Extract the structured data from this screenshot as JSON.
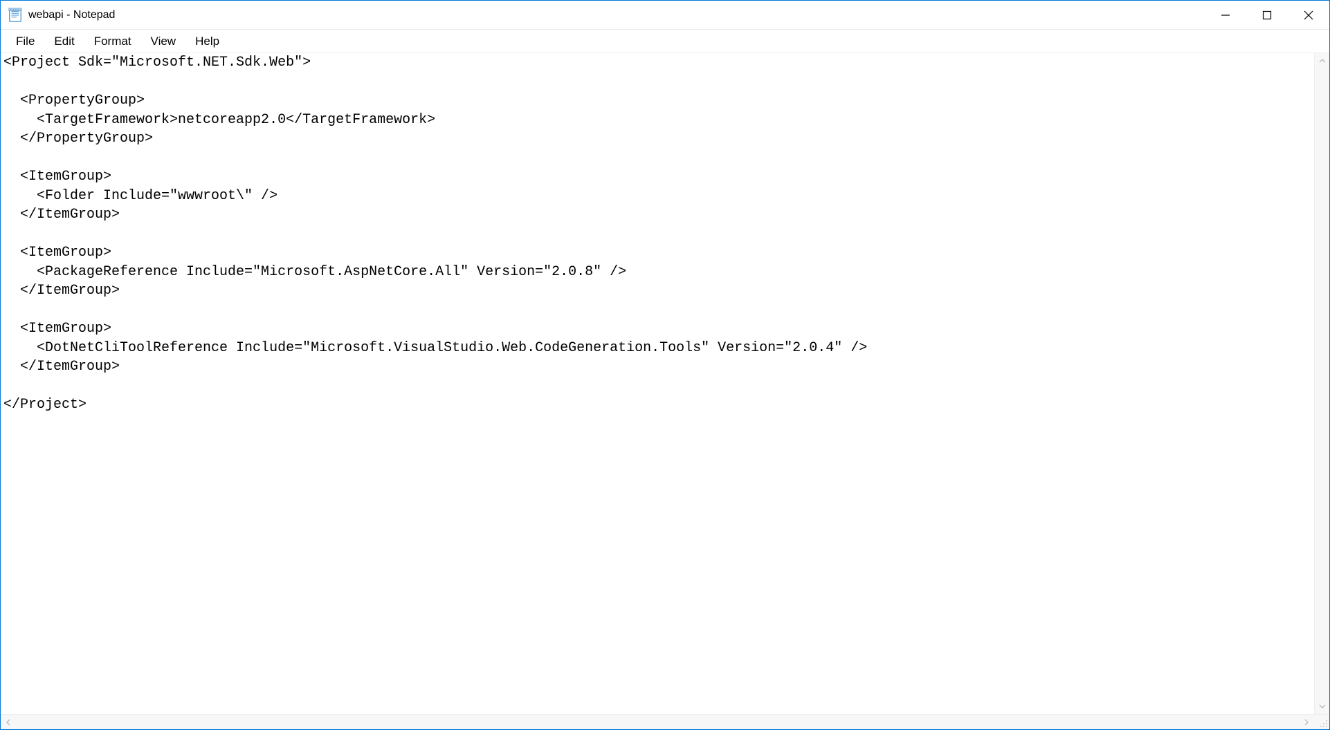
{
  "window": {
    "title": "webapi - Notepad"
  },
  "menu": {
    "file": "File",
    "edit": "Edit",
    "format": "Format",
    "view": "View",
    "help": "Help"
  },
  "editor": {
    "content": "<Project Sdk=\"Microsoft.NET.Sdk.Web\">\n\n  <PropertyGroup>\n    <TargetFramework>netcoreapp2.0</TargetFramework>\n  </PropertyGroup>\n\n  <ItemGroup>\n    <Folder Include=\"wwwroot\\\" />\n  </ItemGroup>\n\n  <ItemGroup>\n    <PackageReference Include=\"Microsoft.AspNetCore.All\" Version=\"2.0.8\" />\n  </ItemGroup>\n\n  <ItemGroup>\n    <DotNetCliToolReference Include=\"Microsoft.VisualStudio.Web.CodeGeneration.Tools\" Version=\"2.0.4\" />\n  </ItemGroup>\n\n</Project>"
  }
}
